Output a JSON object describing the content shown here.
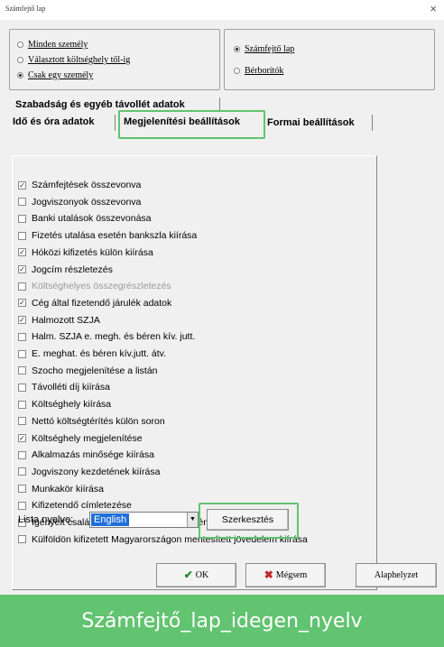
{
  "window": {
    "title": "Számfejtő lap",
    "close_glyph": "×"
  },
  "scope_group": {
    "options": [
      {
        "label": "Minden személy",
        "selected": false
      },
      {
        "label": "Választott költséghely től-ig",
        "selected": false
      },
      {
        "label": "Csak egy személy",
        "selected": true
      }
    ]
  },
  "type_group": {
    "options": [
      {
        "label": "Számfejtő lap",
        "selected": true
      },
      {
        "label": "Bérborítók",
        "selected": false
      }
    ]
  },
  "tabs": {
    "row1": [
      "Szabadság és egyéb távollét adatok"
    ],
    "row2": [
      "Idő és óra adatok",
      "Megjelenítési beállítások",
      "Formai beállítások"
    ],
    "active": "Megjelenítési beállítások"
  },
  "options": [
    {
      "label": "Számfejtések összevonva",
      "checked": true,
      "enabled": true
    },
    {
      "label": "Jogviszonyok összevonva",
      "checked": false,
      "enabled": true
    },
    {
      "label": "Banki utalások összevonása",
      "checked": false,
      "enabled": true
    },
    {
      "label": "Fizetés utalása esetén bankszla kiírása",
      "checked": false,
      "enabled": true
    },
    {
      "label": "Hóközi kifizetés külön kiírása",
      "checked": true,
      "enabled": true
    },
    {
      "label": "Jogcím részletezés",
      "checked": true,
      "enabled": true
    },
    {
      "label": "Költséghelyes összegrészletezés",
      "checked": false,
      "enabled": false
    },
    {
      "label": "Cég által fizetendő járulék adatok",
      "checked": true,
      "enabled": true
    },
    {
      "label": "Halmozott SZJA",
      "checked": true,
      "enabled": true
    },
    {
      "label": "Halm. SZJA e. megh. és béren kív. jutt.",
      "checked": false,
      "enabled": true
    },
    {
      "label": "E. meghat. és béren kív.jutt. átv.",
      "checked": false,
      "enabled": true
    },
    {
      "label": "Szocho megjelenítése a listán",
      "checked": false,
      "enabled": true
    },
    {
      "label": "Távolléti díj kiírása",
      "checked": false,
      "enabled": true
    },
    {
      "label": "Költséghely kiírása",
      "checked": false,
      "enabled": true
    },
    {
      "label": "Nettó költségtérítés külön soron",
      "checked": false,
      "enabled": true
    },
    {
      "label": "Költséghely megjelenítése",
      "checked": true,
      "enabled": true
    },
    {
      "label": "Alkalmazás minősége kiírása",
      "checked": false,
      "enabled": true
    },
    {
      "label": "Jogviszony kezdetének kiírása",
      "checked": false,
      "enabled": true
    },
    {
      "label": "Munkakör kiírása",
      "checked": false,
      "enabled": true
    },
    {
      "label": "Kifizetendő címletezése",
      "checked": false,
      "enabled": true
    },
    {
      "label": "Igényelt családi és első házas kedvezmény kiírása",
      "checked": false,
      "enabled": true
    },
    {
      "label": "Külföldön kifizetett Magyarországon mentesített jövedelem kiírása",
      "checked": false,
      "enabled": true
    }
  ],
  "language": {
    "label": "Lista nyelve:",
    "value": "English",
    "edit_button": "Szerkesztés"
  },
  "buttons": {
    "ok": "OK",
    "cancel": "Mégsem",
    "default": "Alaphelyzet"
  },
  "caption": "Számfejtő_lap_idegen_nyelv",
  "colors": {
    "highlight": "#62c370",
    "selection": "#1e6fd9",
    "cancel_icon": "#c0272d",
    "ok_icon": "#2a8a2a"
  }
}
